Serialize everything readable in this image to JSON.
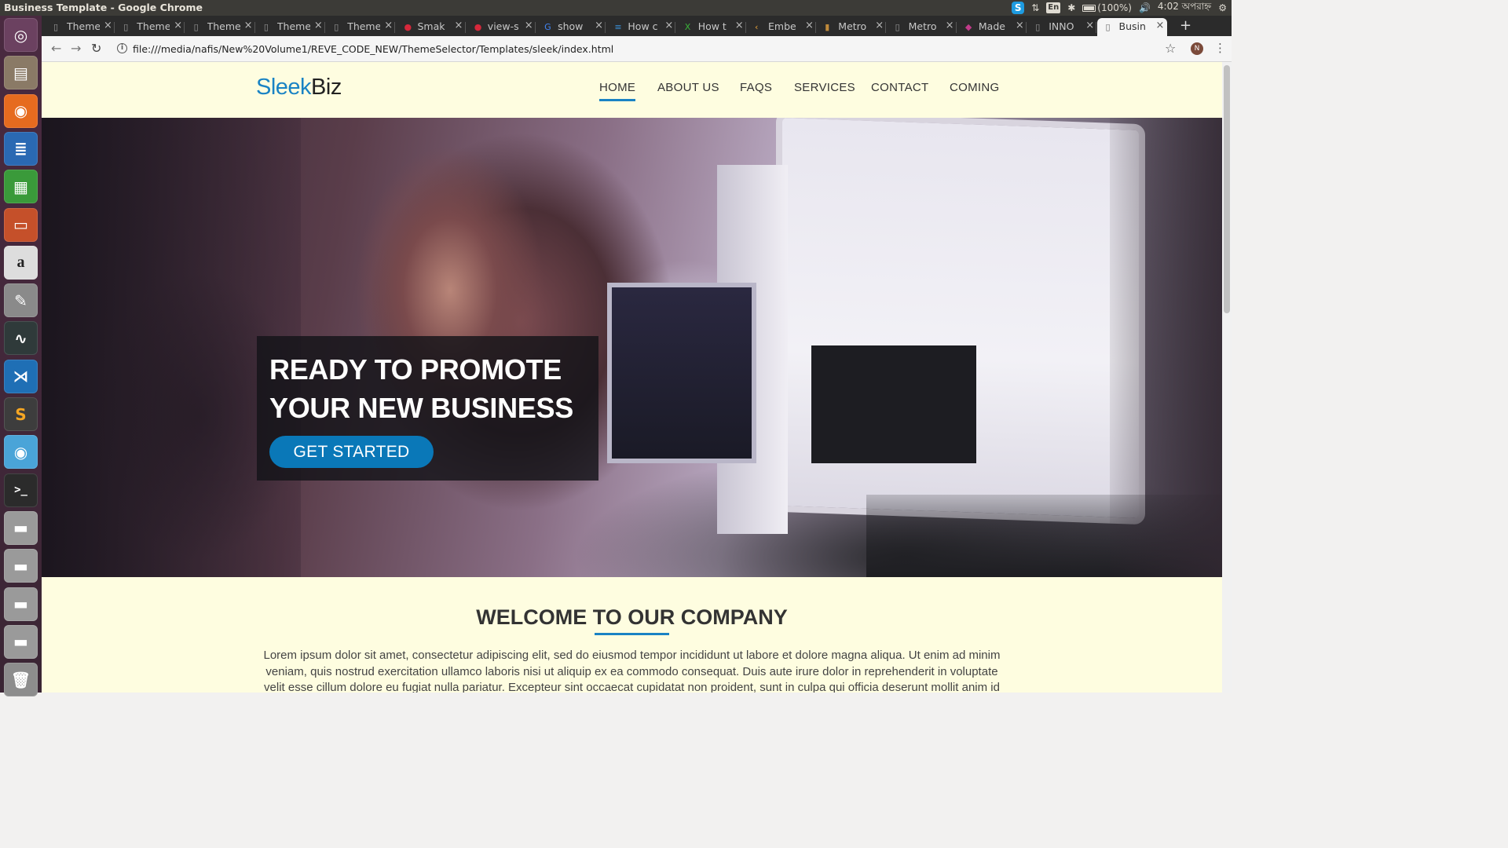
{
  "window": {
    "title": "Business Template - Google Chrome"
  },
  "tray": {
    "skype": "S",
    "keyboard": "En",
    "battery": "(100%)",
    "clock": "4:02 অপরাহ্ন"
  },
  "tabs": [
    {
      "label": "Theme",
      "favicon": "page-icon"
    },
    {
      "label": "Theme",
      "favicon": "page-icon"
    },
    {
      "label": "Theme",
      "favicon": "page-icon"
    },
    {
      "label": "Theme",
      "favicon": "page-icon"
    },
    {
      "label": "Theme",
      "favicon": "page-icon"
    },
    {
      "label": "Smak",
      "favicon": "strawberry-icon"
    },
    {
      "label": "view-s",
      "favicon": "strawberry-icon"
    },
    {
      "label": "show",
      "favicon": "google-icon"
    },
    {
      "label": "How c",
      "favicon": "stackoverflow-icon"
    },
    {
      "label": "How t",
      "favicon": "xul-icon"
    },
    {
      "label": "Embe",
      "favicon": "codepen-icon"
    },
    {
      "label": "Metro",
      "favicon": "template-icon"
    },
    {
      "label": "Metro",
      "favicon": "page-icon"
    },
    {
      "label": "Made",
      "favicon": "made-icon"
    },
    {
      "label": "INNO",
      "favicon": "page-icon"
    },
    {
      "label": "Busin",
      "favicon": "page-icon",
      "active": true
    }
  ],
  "toolbar": {
    "url": "file:///media/nafis/New%20Volume1/REVE_CODE_NEW/ThemeSelector/Templates/sleek/index.html",
    "profile_initial": "N"
  },
  "site": {
    "brand_part1": "Sleek",
    "brand_part2": "Biz",
    "nav": [
      "HOME",
      "ABOUT US",
      "FAQS",
      "SERVICES",
      "CONTACT",
      "COMING"
    ],
    "hero": {
      "title_line1": "READY TO PROMOTE",
      "title_line2": "YOUR NEW BUSINESS",
      "cta": "GET STARTED"
    },
    "welcome": {
      "title": "WELCOME TO OUR COMPANY",
      "text": "Lorem ipsum dolor sit amet, consectetur adipiscing elit, sed do eiusmod tempor incididunt ut labore et dolore magna aliqua. Ut enim ad minim veniam, quis nostrud exercitation ullamco laboris nisi ut aliquip ex ea commodo consequat. Duis aute irure dolor in reprehenderit in voluptate velit esse cillum dolore eu fugiat nulla pariatur. Excepteur sint occaecat cupidatat non proident, sunt in culpa qui officia deserunt mollit anim id est"
    }
  },
  "launcher": [
    {
      "name": "ubuntu-dash-icon",
      "color": "#6b4160"
    },
    {
      "name": "files-icon",
      "color": "#8a7a66"
    },
    {
      "name": "firefox-icon",
      "color": "#e66b1f"
    },
    {
      "name": "writer-icon",
      "color": "#2a69b3"
    },
    {
      "name": "calc-icon",
      "color": "#3a9a3a"
    },
    {
      "name": "impress-icon",
      "color": "#c5502a"
    },
    {
      "name": "amazon-icon",
      "color": "#dddddd"
    },
    {
      "name": "settings-icon",
      "color": "#8a8a8a"
    },
    {
      "name": "system-monitor-icon",
      "color": "#2f3a3a"
    },
    {
      "name": "vscode-icon",
      "color": "#1f6fb5"
    },
    {
      "name": "sublime-icon",
      "color": "#3d3d3d"
    },
    {
      "name": "chrome-icon",
      "color": "#4aa4d8"
    },
    {
      "name": "terminal-icon",
      "color": "#2b2b2b"
    },
    {
      "name": "drive-icon",
      "color": "#9a9a9a"
    },
    {
      "name": "drive-icon",
      "color": "#9a9a9a"
    },
    {
      "name": "drive-icon",
      "color": "#9a9a9a"
    },
    {
      "name": "drive-icon",
      "color": "#9a9a9a"
    },
    {
      "name": "trash-icon",
      "color": "#8d8d8d"
    }
  ]
}
